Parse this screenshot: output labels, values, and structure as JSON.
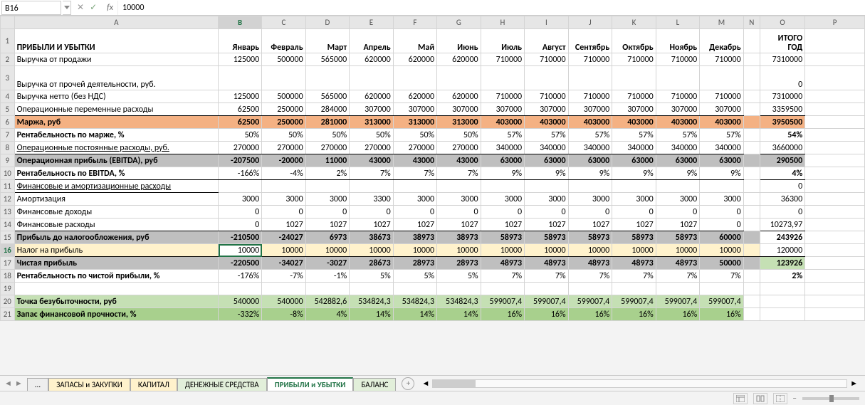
{
  "nameBox": "B16",
  "fxValue": "10000",
  "colHeaders": [
    "A",
    "B",
    "C",
    "D",
    "E",
    "F",
    "G",
    "H",
    "I",
    "J",
    "K",
    "L",
    "M",
    "N",
    "O",
    "P"
  ],
  "months": [
    "Январь",
    "Февраль",
    "Март",
    "Апрель",
    "Май",
    "Июнь",
    "Июль",
    "Август",
    "Сентябрь",
    "Октябрь",
    "Ноябрь",
    "Декабрь"
  ],
  "totalHeader": "ИТОГО ГОД",
  "labels": {
    "r1": "ПРИБЫЛИ И УБЫТКИ",
    "r2": "Выручка от продажи",
    "r3": "Выручка от прочей деятельности, руб.",
    "r4": "Выручка нетто (без НДС)",
    "r5": "Операционные переменные расходы",
    "r6": "Маржа, руб",
    "r7": "Рентабельность по марже, %",
    "r8": "Операционные постоянные расходы, руб.",
    "r9": "Операционная прибыль (EBITDA), руб",
    "r10": "Рентабельность по EBITDA, %",
    "r11": "Финансовые и амортизационные расходы",
    "r12": "Амортизация",
    "r13": "Финансовые доходы",
    "r14": "Финансовые расходы",
    "r15": "Прибыль до налогообложения, руб",
    "r16": "Налог на прибыль",
    "r17": "Чистая прибыль",
    "r18": "Рентабельность по чистой прибыли, %",
    "r20": "Точка безубыточности, руб",
    "r21": "Запас финансовой прочности, %"
  },
  "chart_data": {
    "type": "table",
    "rows": {
      "r2": {
        "v": [
          "125000",
          "500000",
          "565000",
          "620000",
          "620000",
          "620000",
          "710000",
          "710000",
          "710000",
          "710000",
          "710000",
          "710000"
        ],
        "t": "7310000"
      },
      "r3": {
        "v": [
          "",
          "",
          "",
          "",
          "",
          "",
          "",
          "",
          "",
          "",
          "",
          ""
        ],
        "t": "0"
      },
      "r4": {
        "v": [
          "125000",
          "500000",
          "565000",
          "620000",
          "620000",
          "620000",
          "710000",
          "710000",
          "710000",
          "710000",
          "710000",
          "710000"
        ],
        "t": "7310000"
      },
      "r5": {
        "v": [
          "62500",
          "250000",
          "284000",
          "307000",
          "307000",
          "307000",
          "307000",
          "307000",
          "307000",
          "307000",
          "307000",
          "307000"
        ],
        "t": "3359500"
      },
      "r6": {
        "v": [
          "62500",
          "250000",
          "281000",
          "313000",
          "313000",
          "313000",
          "403000",
          "403000",
          "403000",
          "403000",
          "403000",
          "403000"
        ],
        "t": "3950500"
      },
      "r7": {
        "v": [
          "50%",
          "50%",
          "50%",
          "50%",
          "50%",
          "50%",
          "57%",
          "57%",
          "57%",
          "57%",
          "57%",
          "57%"
        ],
        "t": "54%"
      },
      "r8": {
        "v": [
          "270000",
          "270000",
          "270000",
          "270000",
          "270000",
          "270000",
          "340000",
          "340000",
          "340000",
          "340000",
          "340000",
          "340000"
        ],
        "t": "3660000"
      },
      "r9": {
        "v": [
          "-207500",
          "-20000",
          "11000",
          "43000",
          "43000",
          "43000",
          "63000",
          "63000",
          "63000",
          "63000",
          "63000",
          "63000"
        ],
        "t": "290500"
      },
      "r10": {
        "v": [
          "-166%",
          "-4%",
          "2%",
          "7%",
          "7%",
          "7%",
          "9%",
          "9%",
          "9%",
          "9%",
          "9%",
          "9%"
        ],
        "t": "4%"
      },
      "r11": {
        "v": [
          "",
          "",
          "",
          "",
          "",
          "",
          "",
          "",
          "",
          "",
          "",
          ""
        ],
        "t": "0"
      },
      "r12": {
        "v": [
          "3000",
          "3000",
          "3000",
          "3300",
          "3000",
          "3000",
          "3000",
          "3000",
          "3000",
          "3000",
          "3000",
          "3000"
        ],
        "t": "36300"
      },
      "r13": {
        "v": [
          "0",
          "0",
          "0",
          "0",
          "0",
          "0",
          "0",
          "0",
          "0",
          "0",
          "0",
          "0"
        ],
        "t": "0"
      },
      "r14": {
        "v": [
          "0",
          "1027",
          "1027",
          "1027",
          "1027",
          "1027",
          "1027",
          "1027",
          "1027",
          "1027",
          "1027",
          "0"
        ],
        "t": "10273,97"
      },
      "r15": {
        "v": [
          "-210500",
          "-24027",
          "6973",
          "38673",
          "38973",
          "38973",
          "58973",
          "58973",
          "58973",
          "58973",
          "58973",
          "60000"
        ],
        "t": "243926"
      },
      "r16": {
        "v": [
          "10000",
          "10000",
          "10000",
          "10000",
          "10000",
          "10000",
          "10000",
          "10000",
          "10000",
          "10000",
          "10000",
          "10000"
        ],
        "t": "120000"
      },
      "r17": {
        "v": [
          "-220500",
          "-34027",
          "-3027",
          "28673",
          "28973",
          "28973",
          "48973",
          "48973",
          "48973",
          "48973",
          "48973",
          "50000"
        ],
        "t": "123926"
      },
      "r18": {
        "v": [
          "-176%",
          "-7%",
          "-1%",
          "5%",
          "5%",
          "5%",
          "7%",
          "7%",
          "7%",
          "7%",
          "7%",
          "7%"
        ],
        "t": "2%"
      },
      "r20": {
        "v": [
          "540000",
          "540000",
          "542882,6",
          "534824,3",
          "534824,3",
          "534824,3",
          "599007,4",
          "599007,4",
          "599007,4",
          "599007,4",
          "599007,4",
          "599007,4"
        ],
        "t": ""
      },
      "r21": {
        "v": [
          "-332%",
          "-8%",
          "4%",
          "14%",
          "14%",
          "14%",
          "16%",
          "16%",
          "16%",
          "16%",
          "16%",
          "16%"
        ],
        "t": ""
      }
    }
  },
  "tabs": {
    "ellipsis": "...",
    "t1": "ЗАПАСЫ и ЗАКУПКИ",
    "t2": "КАПИТАЛ",
    "t3": "ДЕНЕЖНЫЕ СРЕДСТВА",
    "t4": "ПРИБЫЛИ и УБЫТКИ",
    "t5": "БАЛАНС"
  },
  "activeCell": "B16",
  "selectedCol": "B",
  "selectedRow": 16
}
